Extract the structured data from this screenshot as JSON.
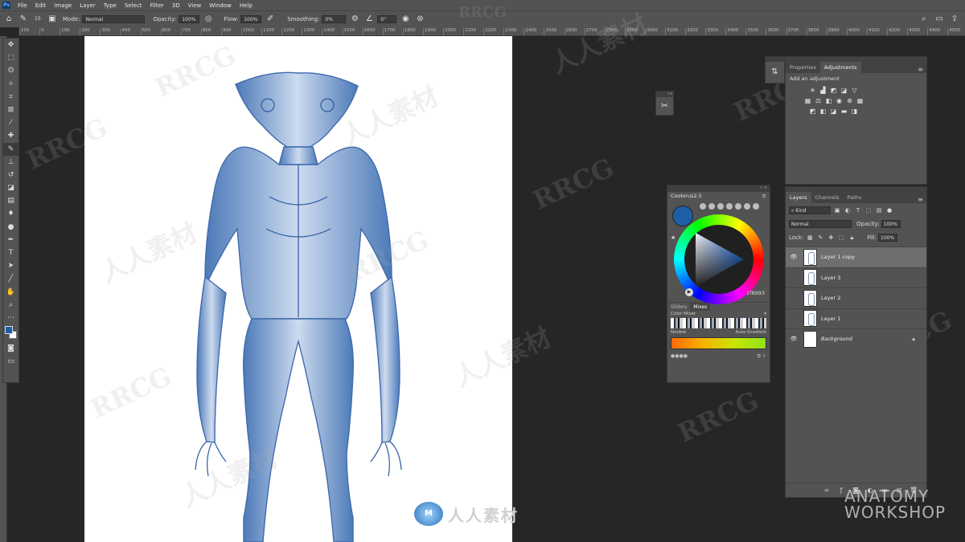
{
  "app": {
    "logo": "Ps",
    "menu": [
      "File",
      "Edit",
      "Image",
      "Layer",
      "Type",
      "Select",
      "Filter",
      "3D",
      "View",
      "Window",
      "Help"
    ]
  },
  "options_bar": {
    "brush_size": "15",
    "mode_label": "Mode:",
    "mode_value": "Normal",
    "opacity_label": "Opacity:",
    "opacity_value": "100%",
    "flow_label": "Flow:",
    "flow_value": "100%",
    "smoothing_label": "Smoothing:",
    "smoothing_value": "0%",
    "angle_value": "0°"
  },
  "ruler_marks": [
    "100",
    "0",
    "100",
    "200",
    "300",
    "400",
    "500",
    "600",
    "700",
    "800",
    "900",
    "1000",
    "1100",
    "1200",
    "1300",
    "1400",
    "1500",
    "1600",
    "1700",
    "1800",
    "1900",
    "2000",
    "2100",
    "2200",
    "2300",
    "2400",
    "2500",
    "2600",
    "2700",
    "2800",
    "2900",
    "3000",
    "3100",
    "3200",
    "3300",
    "3400",
    "3500",
    "3600",
    "3700",
    "3800",
    "3900",
    "4000",
    "4100",
    "4200",
    "4300",
    "4400",
    "4500",
    "4600",
    "4700",
    "4800",
    "4900",
    "5000",
    "5100"
  ],
  "colors": {
    "foreground": "#1b5fa8",
    "background": "#ffffff",
    "accent": "#1e6fe6"
  },
  "coolorus": {
    "title": "Coolorus2.5",
    "hex": "1f8993",
    "tab_sliders": "Sliders",
    "tab_mixes": "Mixes",
    "color_mixer_label": "Color Mixer",
    "gradient_label": "Noobie",
    "gradient_right": "Auto Gradient"
  },
  "adjustments_panel": {
    "tab_properties": "Properties",
    "tab_adjustments": "Adjustments",
    "add_label": "Add an adjustment"
  },
  "layers_panel": {
    "tab_layers": "Layers",
    "tab_channels": "Channels",
    "tab_paths": "Paths",
    "kind_filter": "Kind",
    "blend_mode": "Normal",
    "opacity_label": "Opacity:",
    "opacity_value": "100%",
    "lock_label": "Lock:",
    "fill_label": "Fill:",
    "fill_value": "100%",
    "layers": [
      {
        "name": "Layer 1 copy",
        "visible": true,
        "selected": true
      },
      {
        "name": "Layer 3",
        "visible": false,
        "selected": false
      },
      {
        "name": "Layer 2",
        "visible": false,
        "selected": false
      },
      {
        "name": "Layer 1",
        "visible": false,
        "selected": false
      },
      {
        "name": "Background",
        "visible": true,
        "selected": false
      }
    ]
  },
  "watermarks": {
    "brand": "RRCG",
    "brand_cn": "人人素材",
    "bottom_logo_text": "人人素材",
    "anatomy_line1": "ANATOMY",
    "anatomy_line2": "WORKSHOP"
  }
}
